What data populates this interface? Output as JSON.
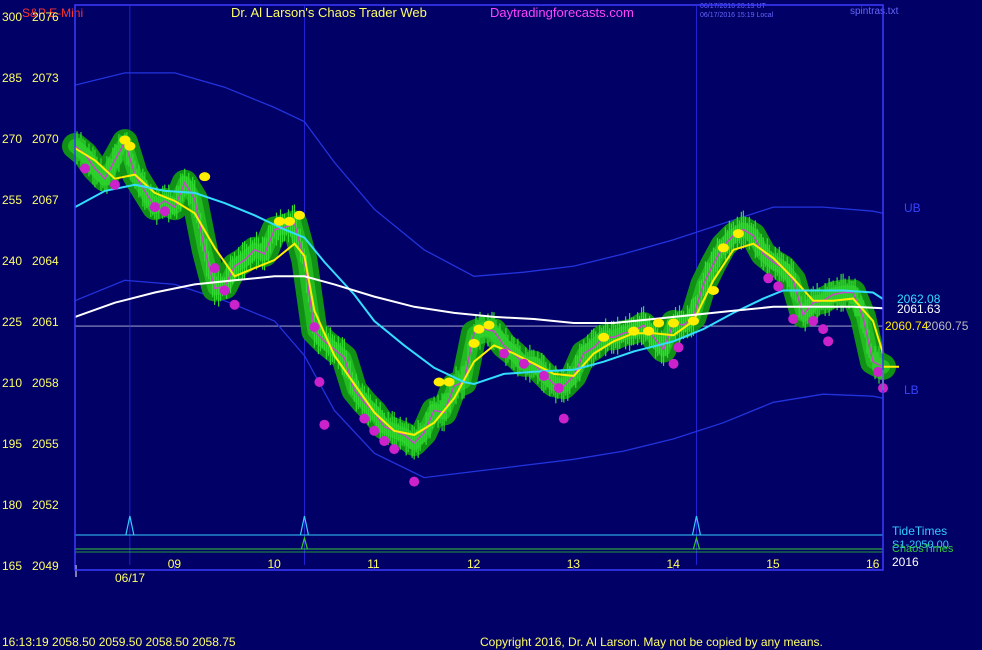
{
  "header": {
    "instrument": "S&P E-Mini",
    "title": "Dr. Al Larson's Chaos Trader Web",
    "site": "Daytradingforecasts.com",
    "stamp_utc": "06/17/2016 20:19 UT",
    "stamp_local": "06/17/2016 15:19 Local",
    "file": "spintras.txt"
  },
  "footer": {
    "last_bar": "16:13:19  2058.50 2059.50 2058.50 2058.75",
    "copyright": "Copyright 2016, Dr. Al Larson. May not be copied by any means."
  },
  "colors": {
    "background": "#000066",
    "frame": "#3a3aff",
    "price_green": "#33dd33",
    "glow_green": "#119911",
    "yellow": "#ffee00",
    "magenta": "#cc22cc",
    "cyan": "#33ddff",
    "white": "#ffffff",
    "band_blue": "#2233dd",
    "tide_cyan": "#33ccff",
    "chaos_green": "#33cc33",
    "text_red": "#ff3333",
    "text_yellow": "#ffff66",
    "text_magenta": "#ff44ff"
  },
  "chart_data": {
    "type": "line",
    "time_labels": [
      "09",
      "10",
      "11",
      "12",
      "13",
      "14",
      "15",
      "16"
    ],
    "time_label_x": [
      9,
      10,
      11,
      12,
      13,
      14,
      15,
      16
    ],
    "date_label": "06/17",
    "year_label": "2016",
    "y_left_ticks": [
      "300",
      "285",
      "270",
      "255",
      "240",
      "225",
      "210",
      "195",
      "180",
      "165"
    ],
    "y_right_ticks": [
      "2076",
      "2073",
      "2070",
      "2067",
      "2064",
      "2061",
      "2058",
      "2055",
      "2052",
      "2049"
    ],
    "ylim": [
      2049,
      2076
    ],
    "xlim": [
      8.0,
      16.1
    ],
    "price": {
      "x": [
        8.0,
        8.1,
        8.2,
        8.3,
        8.4,
        8.5,
        8.6,
        8.7,
        8.8,
        8.9,
        9.0,
        9.1,
        9.2,
        9.3,
        9.4,
        9.5,
        9.6,
        9.7,
        9.8,
        9.9,
        10.0,
        10.1,
        10.2,
        10.3,
        10.4,
        10.5,
        10.6,
        10.7,
        10.8,
        10.9,
        11.0,
        11.1,
        11.2,
        11.3,
        11.4,
        11.5,
        11.6,
        11.7,
        11.8,
        11.9,
        12.0,
        12.1,
        12.2,
        12.3,
        12.4,
        12.5,
        12.6,
        12.7,
        12.8,
        12.9,
        13.0,
        13.1,
        13.2,
        13.3,
        13.4,
        13.5,
        13.6,
        13.7,
        13.8,
        13.9,
        14.0,
        14.1,
        14.2,
        14.3,
        14.4,
        14.5,
        14.6,
        14.7,
        14.8,
        14.9,
        15.0,
        15.1,
        15.2,
        15.3,
        15.4,
        15.5,
        15.6,
        15.7,
        15.8,
        15.9,
        16.0,
        16.1
      ],
      "y": [
        2069.6,
        2069.2,
        2068.5,
        2068.0,
        2068.9,
        2069.8,
        2068.2,
        2067.4,
        2066.6,
        2066.9,
        2066.6,
        2067.8,
        2067.0,
        2064.5,
        2062.6,
        2062.7,
        2063.7,
        2064.0,
        2064.5,
        2064.3,
        2065.5,
        2065.6,
        2065.8,
        2064.0,
        2060.5,
        2060.0,
        2059.6,
        2059.2,
        2057.6,
        2057.0,
        2056.5,
        2055.8,
        2055.6,
        2055.4,
        2055.0,
        2055.5,
        2056.6,
        2056.5,
        2057.8,
        2058.0,
        2060.4,
        2060.6,
        2060.5,
        2059.8,
        2059.4,
        2058.9,
        2058.9,
        2058.4,
        2057.9,
        2057.8,
        2058.3,
        2059.4,
        2059.7,
        2060.2,
        2060.2,
        2060.4,
        2060.5,
        2060.8,
        2060.2,
        2059.6,
        2060.9,
        2060.8,
        2061.2,
        2062.8,
        2063.8,
        2064.7,
        2065.2,
        2065.5,
        2065.2,
        2064.3,
        2063.9,
        2063.6,
        2063.0,
        2061.3,
        2061.9,
        2062.0,
        2062.3,
        2062.4,
        2062.4,
        2061.2,
        2059.0,
        2058.75
      ]
    },
    "series": [
      {
        "name": "",
        "type": "fast_average",
        "color": "yellow",
        "x": [
          8.0,
          8.2,
          8.4,
          8.6,
          8.8,
          9.0,
          9.2,
          9.4,
          9.6,
          9.8,
          10.0,
          10.2,
          10.3,
          10.4,
          10.6,
          10.8,
          11.0,
          11.2,
          11.4,
          11.6,
          11.8,
          12.0,
          12.2,
          12.4,
          12.6,
          12.8,
          13.0,
          13.2,
          13.4,
          13.6,
          13.8,
          14.0,
          14.2,
          14.4,
          14.6,
          14.8,
          15.0,
          15.2,
          15.4,
          15.6,
          15.8,
          16.0,
          16.1
        ],
        "y": [
          2069.5,
          2068.9,
          2068.0,
          2068.2,
          2067.3,
          2066.9,
          2066.3,
          2064.6,
          2063.2,
          2063.6,
          2064.0,
          2064.8,
          2064.2,
          2061.5,
          2059.3,
          2057.9,
          2056.5,
          2055.6,
          2055.4,
          2056.0,
          2057.2,
          2059.0,
          2059.8,
          2059.4,
          2058.9,
          2058.4,
          2058.3,
          2059.4,
          2060.0,
          2060.4,
          2060.4,
          2060.3,
          2061.0,
          2063.0,
          2064.5,
          2064.8,
          2064.1,
          2063.1,
          2062.0,
          2062.0,
          2062.1,
          2061.0,
          2059.4
        ]
      },
      {
        "name": "",
        "type": "slow_average",
        "color": "cyan",
        "x": [
          8.0,
          8.3,
          8.6,
          8.9,
          9.2,
          9.5,
          9.8,
          10.1,
          10.3,
          10.5,
          10.8,
          11.0,
          11.3,
          11.6,
          11.9,
          12.0,
          12.3,
          12.6,
          13.0,
          13.3,
          13.6,
          14.0,
          14.3,
          14.6,
          14.9,
          15.1,
          15.4,
          15.7,
          16.0,
          16.1
        ],
        "y": [
          2066.6,
          2067.4,
          2067.7,
          2067.4,
          2067.3,
          2066.8,
          2066.2,
          2065.5,
          2065.1,
          2063.9,
          2062.3,
          2061.0,
          2059.8,
          2058.7,
          2058.0,
          2057.9,
          2058.4,
          2058.5,
          2058.6,
          2059.0,
          2059.5,
          2060.0,
          2060.6,
          2061.4,
          2062.1,
          2062.5,
          2062.5,
          2062.5,
          2062.4,
          2062.08
        ]
      },
      {
        "name": "",
        "type": "long_average",
        "color": "white",
        "x": [
          8.0,
          8.4,
          8.8,
          9.2,
          9.6,
          10.0,
          10.3,
          10.6,
          11.0,
          11.4,
          11.8,
          12.2,
          12.6,
          13.0,
          13.4,
          13.8,
          14.2,
          14.6,
          15.0,
          15.4,
          15.8,
          16.1
        ],
        "y": [
          2061.2,
          2061.9,
          2062.4,
          2062.8,
          2063.0,
          2063.2,
          2063.2,
          2062.8,
          2062.2,
          2061.7,
          2061.4,
          2061.2,
          2061.1,
          2060.9,
          2060.9,
          2061.1,
          2061.3,
          2061.5,
          2061.7,
          2061.7,
          2061.7,
          2061.63
        ]
      },
      {
        "name": "",
        "type": "upper_band",
        "color": "blue",
        "x": [
          8.0,
          8.5,
          9.0,
          9.5,
          10.0,
          10.3,
          10.6,
          11.0,
          11.5,
          12.0,
          12.5,
          13.0,
          13.5,
          14.0,
          14.5,
          15.0,
          15.5,
          16.0,
          16.1
        ],
        "y": [
          2072.6,
          2073.2,
          2073.2,
          2072.5,
          2071.5,
          2070.8,
          2068.8,
          2066.5,
          2064.5,
          2063.2,
          2063.4,
          2063.7,
          2064.3,
          2065.0,
          2065.8,
          2066.6,
          2066.6,
          2066.4,
          2066.3
        ]
      },
      {
        "name": "",
        "type": "lower_band",
        "color": "blue",
        "x": [
          8.0,
          8.5,
          9.0,
          9.5,
          10.0,
          10.3,
          10.6,
          11.0,
          11.5,
          12.0,
          12.5,
          13.0,
          13.5,
          14.0,
          14.5,
          15.0,
          15.5,
          16.0,
          16.1
        ],
        "y": [
          2062.0,
          2063.0,
          2062.8,
          2062.0,
          2061.0,
          2059.3,
          2056.6,
          2054.5,
          2053.3,
          2053.6,
          2053.9,
          2054.2,
          2054.6,
          2055.2,
          2056.0,
          2057.0,
          2057.4,
          2057.3,
          2057.2
        ]
      }
    ],
    "highs_marked": [
      {
        "x": 8.5,
        "y": 2069.9
      },
      {
        "x": 8.55,
        "y": 2069.6
      },
      {
        "x": 9.3,
        "y": 2068.1
      },
      {
        "x": 10.05,
        "y": 2065.9
      },
      {
        "x": 10.15,
        "y": 2065.9
      },
      {
        "x": 10.25,
        "y": 2066.2
      },
      {
        "x": 11.65,
        "y": 2058.0
      },
      {
        "x": 11.75,
        "y": 2058.0
      },
      {
        "x": 12.05,
        "y": 2060.6
      },
      {
        "x": 12.15,
        "y": 2060.8
      },
      {
        "x": 12.0,
        "y": 2059.9
      },
      {
        "x": 13.3,
        "y": 2060.2
      },
      {
        "x": 13.6,
        "y": 2060.5
      },
      {
        "x": 13.75,
        "y": 2060.5
      },
      {
        "x": 13.85,
        "y": 2060.9
      },
      {
        "x": 14.0,
        "y": 2060.9
      },
      {
        "x": 14.2,
        "y": 2061.0
      },
      {
        "x": 14.4,
        "y": 2062.5
      },
      {
        "x": 14.5,
        "y": 2064.6
      },
      {
        "x": 14.65,
        "y": 2065.3
      }
    ],
    "lows_marked": [
      {
        "x": 8.1,
        "y": 2068.5
      },
      {
        "x": 8.4,
        "y": 2067.7
      },
      {
        "x": 8.8,
        "y": 2066.6
      },
      {
        "x": 8.9,
        "y": 2066.4
      },
      {
        "x": 9.4,
        "y": 2063.6
      },
      {
        "x": 9.5,
        "y": 2062.5
      },
      {
        "x": 9.6,
        "y": 2061.8
      },
      {
        "x": 10.4,
        "y": 2060.7
      },
      {
        "x": 10.45,
        "y": 2058.0
      },
      {
        "x": 10.5,
        "y": 2055.9
      },
      {
        "x": 10.9,
        "y": 2056.2
      },
      {
        "x": 11.0,
        "y": 2055.6
      },
      {
        "x": 11.1,
        "y": 2055.1
      },
      {
        "x": 11.2,
        "y": 2054.7
      },
      {
        "x": 11.4,
        "y": 2053.1
      },
      {
        "x": 12.3,
        "y": 2059.4
      },
      {
        "x": 12.5,
        "y": 2058.9
      },
      {
        "x": 12.7,
        "y": 2058.3
      },
      {
        "x": 12.85,
        "y": 2057.7
      },
      {
        "x": 12.9,
        "y": 2056.2
      },
      {
        "x": 14.05,
        "y": 2059.7
      },
      {
        "x": 14.0,
        "y": 2058.9
      },
      {
        "x": 14.95,
        "y": 2063.1
      },
      {
        "x": 15.05,
        "y": 2062.7
      },
      {
        "x": 15.2,
        "y": 2061.1
      },
      {
        "x": 15.4,
        "y": 2061.0
      },
      {
        "x": 15.5,
        "y": 2060.6
      },
      {
        "x": 15.55,
        "y": 2060.0
      },
      {
        "x": 16.05,
        "y": 2058.5
      },
      {
        "x": 16.1,
        "y": 2057.7
      }
    ],
    "right_labels": {
      "ub": "UB",
      "lb": "LB",
      "cyan_value": "2062.08",
      "white_value": "2061.63",
      "yellow_value": "2060.74",
      "last_value": "2060.75",
      "tide": "TideTimes",
      "chaos": "ChaosTimes",
      "chaos_value": "S1-2050.00"
    },
    "tide_markers_x": [
      8.55,
      10.3,
      14.23
    ],
    "chaos_markers_x": [
      10.3,
      14.23
    ],
    "price_level_line": 2060.75
  }
}
